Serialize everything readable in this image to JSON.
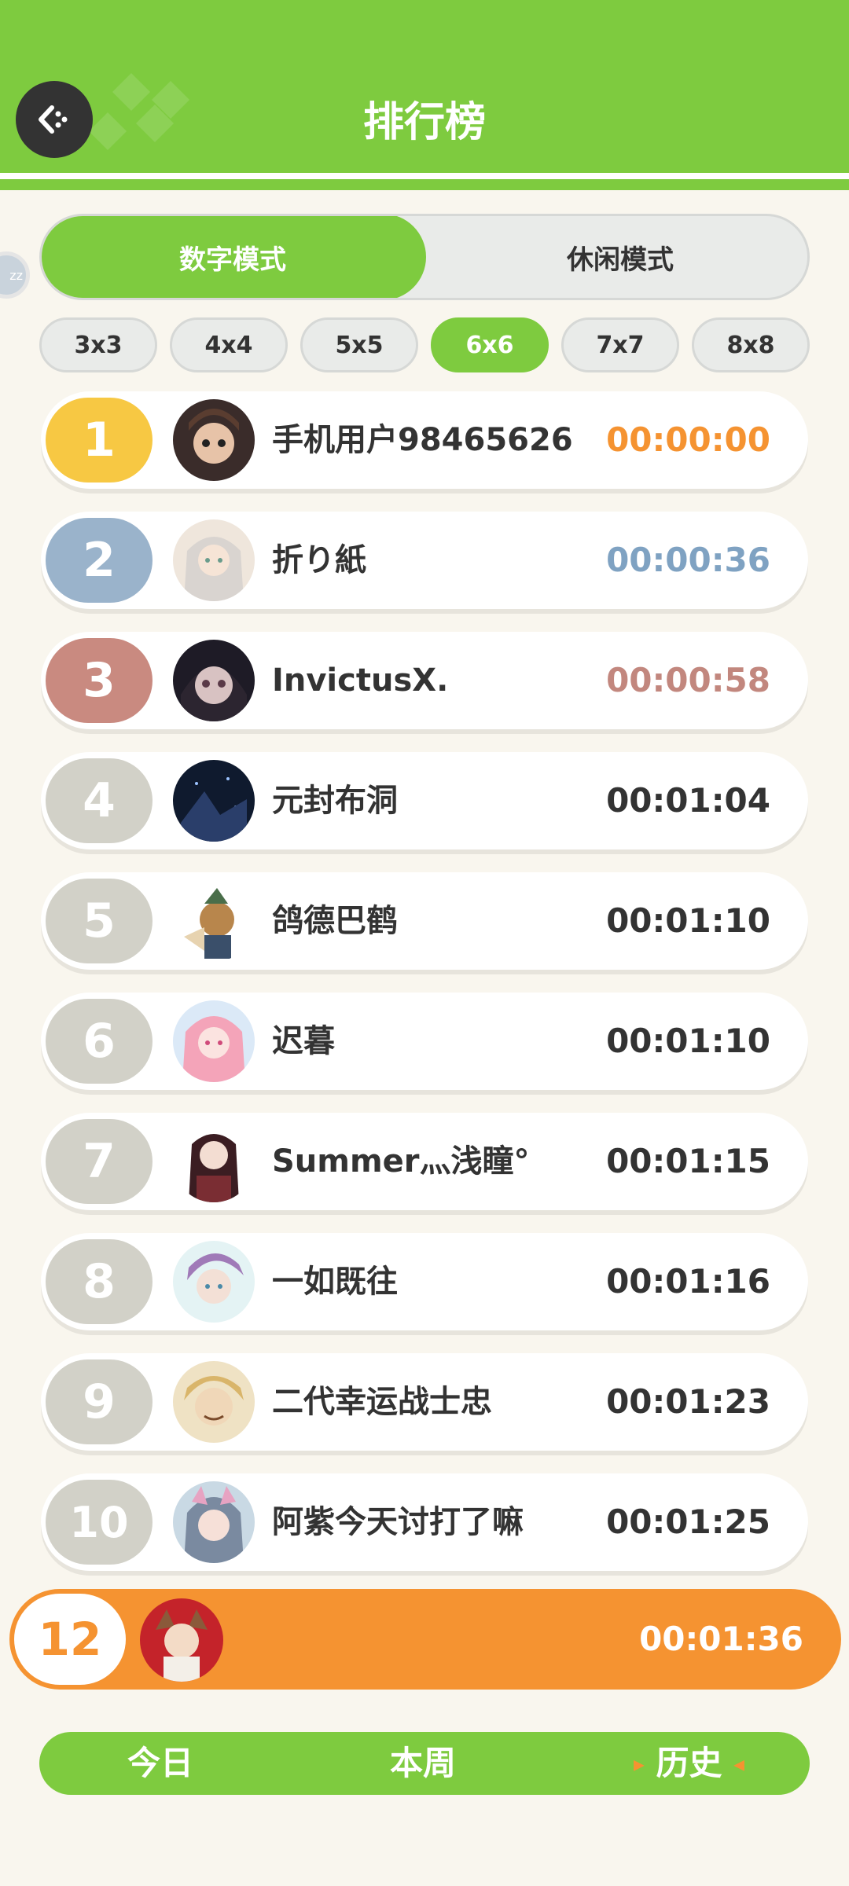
{
  "header": {
    "title": "排行榜"
  },
  "modes": [
    {
      "label": "数字模式"
    },
    {
      "label": "休闲模式"
    }
  ],
  "sizes": [
    {
      "label": "3x3"
    },
    {
      "label": "4x4"
    },
    {
      "label": "5x5"
    },
    {
      "label": "6x6"
    },
    {
      "label": "7x7"
    },
    {
      "label": "8x8"
    }
  ],
  "leaderboard": [
    {
      "rank": "1",
      "name": "手机用户98465626",
      "time": "00:00:00"
    },
    {
      "rank": "2",
      "name": "折り紙",
      "time": "00:00:36"
    },
    {
      "rank": "3",
      "name": "InvictusX.",
      "time": "00:00:58"
    },
    {
      "rank": "4",
      "name": "元封布洞",
      "time": "00:01:04"
    },
    {
      "rank": "5",
      "name": "鸽德巴鹤",
      "time": "00:01:10"
    },
    {
      "rank": "6",
      "name": "迟暮",
      "time": "00:01:10"
    },
    {
      "rank": "7",
      "name": "Summer灬浅瞳°",
      "time": "00:01:15"
    },
    {
      "rank": "8",
      "name": "一如既往",
      "time": "00:01:16"
    },
    {
      "rank": "9",
      "name": "二代幸运战士忠",
      "time": "00:01:23"
    },
    {
      "rank": "10",
      "name": "阿紫今天讨打了嘛",
      "time": "00:01:25"
    }
  ],
  "me": {
    "rank": "12",
    "time": "00:01:36"
  },
  "periods": [
    {
      "label": "今日"
    },
    {
      "label": "本周"
    },
    {
      "label": "历史"
    }
  ],
  "colors": {
    "green": "#7ecb3f",
    "orange": "#f59331",
    "gold": "#f7c843",
    "silver": "#9ab3cb",
    "bronze": "#c98a80",
    "gray": "#d2d1c8"
  }
}
